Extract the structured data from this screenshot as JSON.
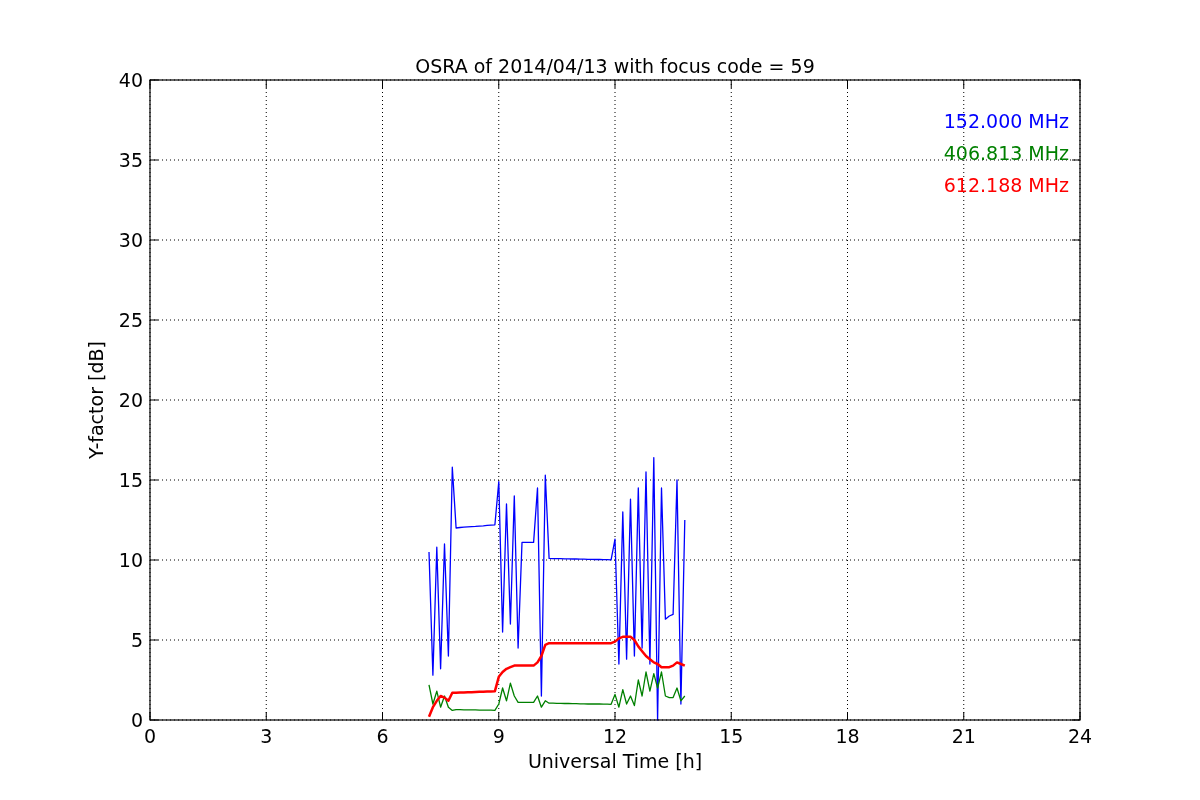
{
  "chart_data": {
    "type": "line",
    "title": "OSRA of 2014/04/13 with focus code = 59",
    "xlabel": "Universal Time [h]",
    "ylabel": "Y-factor [dB]",
    "xlim": [
      0,
      24
    ],
    "ylim": [
      0,
      40
    ],
    "xticks": [
      0,
      3,
      6,
      9,
      12,
      15,
      18,
      21,
      24
    ],
    "yticks": [
      0,
      5,
      10,
      15,
      20,
      25,
      30,
      35,
      40
    ],
    "grid": true,
    "x": [
      7.2,
      7.3,
      7.4,
      7.5,
      7.6,
      7.7,
      7.8,
      7.9,
      8.0,
      8.1,
      8.2,
      8.3,
      8.4,
      8.5,
      8.6,
      8.7,
      8.8,
      8.9,
      9.0,
      9.1,
      9.2,
      9.3,
      9.4,
      9.5,
      9.6,
      9.7,
      9.8,
      9.9,
      10.0,
      10.1,
      10.2,
      10.3,
      10.4,
      10.5,
      10.6,
      10.7,
      10.8,
      10.9,
      11.0,
      11.1,
      11.2,
      11.3,
      11.4,
      11.5,
      11.6,
      11.7,
      11.8,
      11.9,
      12.0,
      12.1,
      12.2,
      12.3,
      12.4,
      12.5,
      12.6,
      12.7,
      12.8,
      12.9,
      13.0,
      13.1,
      13.2,
      13.3,
      13.4,
      13.5,
      13.6,
      13.7,
      13.8
    ],
    "series": [
      {
        "name": "152.000 MHz",
        "color": "#0000ff",
        "values": [
          10.5,
          2.8,
          10.8,
          3.2,
          11,
          4,
          15.8,
          12.0,
          12.03,
          12.05,
          12.07,
          12.09,
          12.1,
          12.12,
          12.14,
          12.16,
          12.18,
          12.2,
          14.9,
          5.5,
          13.5,
          6,
          14,
          4.5,
          11.1,
          11.1,
          11.1,
          11.1,
          14.5,
          1.5,
          15.3,
          10.1,
          10.09,
          10.08,
          10.08,
          10.07,
          10.07,
          10.06,
          10.06,
          10.05,
          10.05,
          10.04,
          10.04,
          10.03,
          10.03,
          10.02,
          10.02,
          10.01,
          11.3,
          3.5,
          13,
          3.8,
          13.8,
          4,
          14.5,
          4.5,
          15.5,
          3.5,
          16.4,
          0,
          14.5,
          6.3,
          6.5,
          6.6,
          15,
          1,
          12.5
        ]
      },
      {
        "name": "406.813 MHz",
        "color": "#008000",
        "values": [
          2.2,
          1.0,
          1.8,
          0.8,
          1.5,
          0.8,
          0.6,
          0.65,
          0.65,
          0.64,
          0.64,
          0.63,
          0.63,
          0.62,
          0.62,
          0.61,
          0.61,
          0.6,
          1.0,
          2.0,
          1.2,
          2.3,
          1.5,
          1.1,
          1.1,
          1.1,
          1.1,
          1.1,
          1.5,
          0.8,
          1.2,
          1.05,
          1.05,
          1.04,
          1.04,
          1.03,
          1.03,
          1.02,
          1.02,
          1.01,
          1.01,
          1.0,
          1.0,
          1.0,
          1.0,
          0.99,
          0.99,
          0.98,
          1.6,
          0.8,
          1.9,
          1.0,
          1.5,
          0.9,
          2.5,
          1.5,
          3.0,
          1.8,
          2.9,
          2.0,
          3.0,
          1.5,
          1.4,
          1.4,
          2.0,
          1.2,
          1.5
        ]
      },
      {
        "name": "612.188 MHz",
        "color": "#ff0000",
        "values": [
          0.2,
          0.8,
          1.2,
          1.5,
          1.4,
          1.2,
          1.7,
          1.7,
          1.71,
          1.72,
          1.73,
          1.74,
          1.75,
          1.76,
          1.77,
          1.78,
          1.79,
          1.8,
          2.7,
          3.0,
          3.2,
          3.3,
          3.4,
          3.4,
          3.4,
          3.4,
          3.4,
          3.4,
          3.6,
          4.0,
          4.7,
          4.8,
          4.8,
          4.8,
          4.8,
          4.8,
          4.8,
          4.8,
          4.8,
          4.8,
          4.8,
          4.8,
          4.8,
          4.8,
          4.8,
          4.8,
          4.8,
          4.8,
          4.9,
          5.1,
          5.2,
          5.2,
          5.2,
          5.0,
          4.6,
          4.3,
          4.0,
          3.8,
          3.6,
          3.5,
          3.3,
          3.3,
          3.3,
          3.4,
          3.6,
          3.5,
          3.4
        ]
      }
    ]
  }
}
